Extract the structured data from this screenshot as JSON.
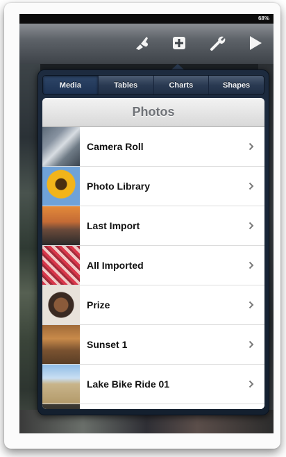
{
  "status": {
    "battery": "68%"
  },
  "toolbar": {
    "buttons": [
      {
        "name": "paintbrush-icon"
      },
      {
        "name": "add-icon"
      },
      {
        "name": "wrench-icon"
      },
      {
        "name": "play-icon"
      }
    ]
  },
  "popover": {
    "tabs": [
      {
        "label": "Media",
        "active": true
      },
      {
        "label": "Tables",
        "active": false
      },
      {
        "label": "Charts",
        "active": false
      },
      {
        "label": "Shapes",
        "active": false
      }
    ],
    "title": "Photos",
    "albums": [
      {
        "label": "Camera Roll"
      },
      {
        "label": "Photo Library"
      },
      {
        "label": "Last Import"
      },
      {
        "label": "All Imported"
      },
      {
        "label": "Prize"
      },
      {
        "label": "Sunset 1"
      },
      {
        "label": "Lake Bike Ride 01"
      }
    ]
  }
}
